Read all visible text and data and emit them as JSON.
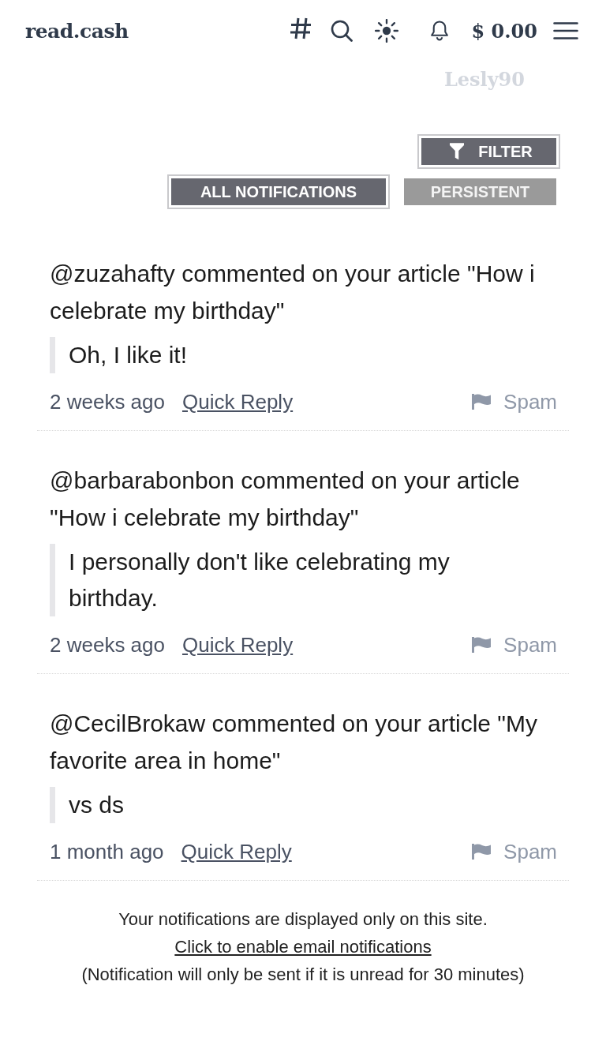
{
  "header": {
    "logo": "read.cash",
    "balance": "$ 0.00",
    "username": "Lesly90"
  },
  "filter_button": {
    "label": "FILTER"
  },
  "tabs": [
    {
      "label": "ALL NOTIFICATIONS",
      "selected": true
    },
    {
      "label": "PERSISTENT",
      "selected": false
    }
  ],
  "notifications": [
    {
      "text": "@zuzahafty commented on your article \"How i celebrate my birthday\"",
      "quote": "Oh, I like it!",
      "time": "2 weeks ago",
      "reply_link": "Quick Reply",
      "spam_label": "Spam"
    },
    {
      "text": "@barbarabonbon commented on your article \"How i celebrate my birthday\"",
      "quote": "I personally don't like celebrating my birthday.",
      "time": "2 weeks ago",
      "reply_link": "Quick Reply",
      "spam_label": "Spam"
    },
    {
      "text": "@CecilBrokaw commented on your article \"My favorite area in home\"",
      "quote": "vs ds",
      "time": "1 month ago",
      "reply_link": "Quick Reply",
      "spam_label": "Spam"
    }
  ],
  "footer": {
    "note": "Your notifications are displayed only on this site.",
    "link": "Click to enable email notifications",
    "disclaimer": "(Notification will only be sent if it is unread for 30 minutes)"
  }
}
